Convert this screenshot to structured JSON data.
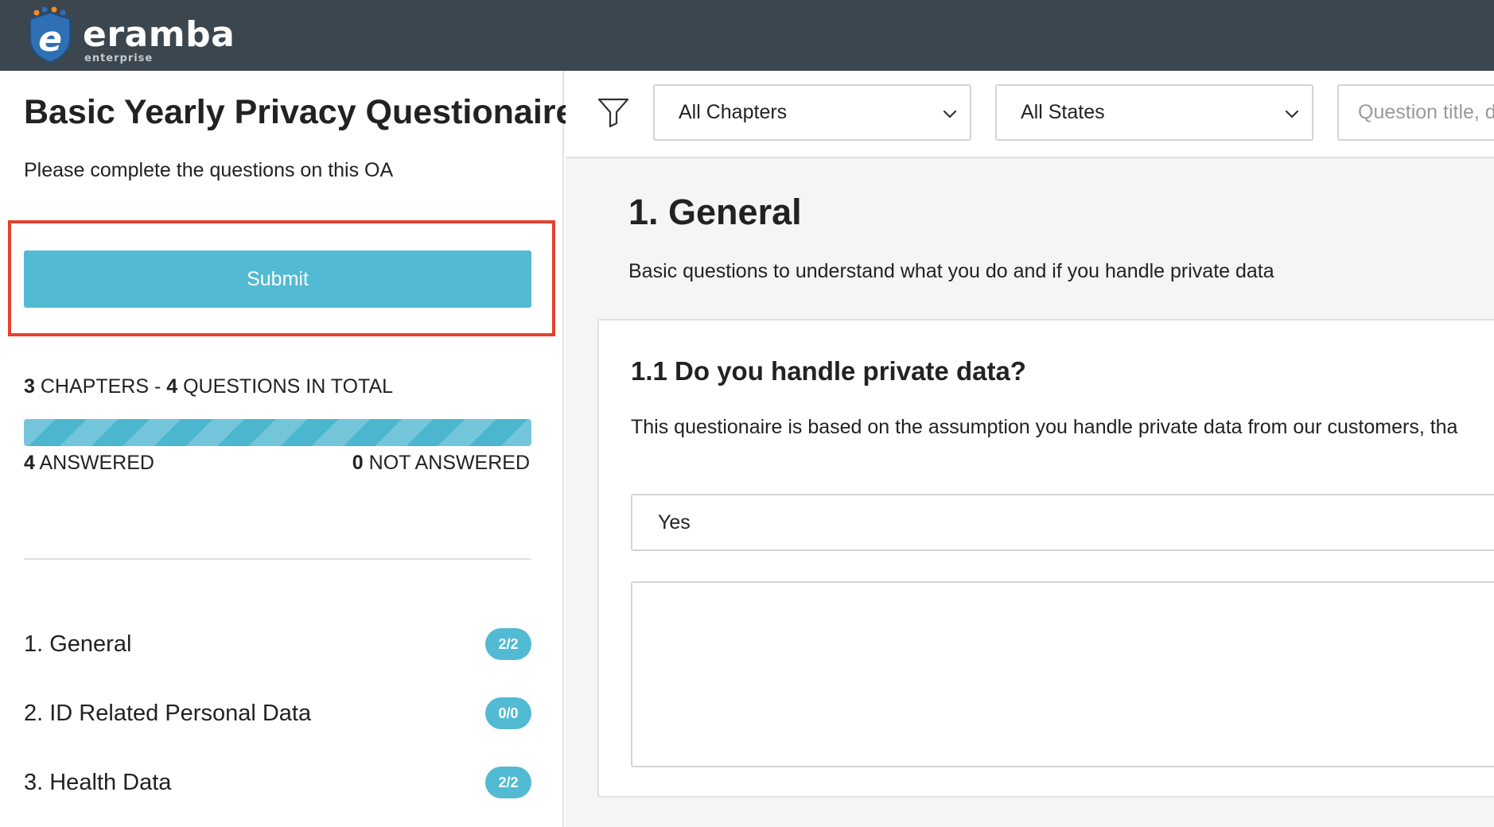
{
  "brand": {
    "name": "eramba",
    "edition": "enterprise",
    "colors": {
      "topbar": "#3b464f",
      "accent": "#52bad2",
      "highlight": "#e5412d"
    }
  },
  "sidebar": {
    "title": "Basic Yearly Privacy Questionaire",
    "description": "Please complete the questions on this OA",
    "submit_label": "Submit",
    "totals": {
      "chapters_count": "3",
      "chapters_text": "CHAPTERS -",
      "questions_count": "4",
      "questions_text": "QUESTIONS IN TOTAL"
    },
    "progress": {
      "answered_fraction": 1.0,
      "answered_count": "4",
      "answered_label": "ANSWERED",
      "not_answered_count": "0",
      "not_answered_label": "NOT ANSWERED"
    },
    "chapters": [
      {
        "label": "1. General",
        "badge": "2/2"
      },
      {
        "label": "2. ID Related Personal Data",
        "badge": "0/0"
      },
      {
        "label": "3. Health Data",
        "badge": "2/2"
      }
    ]
  },
  "filters": {
    "icon": "filter-icon",
    "chapter_select": "All Chapters",
    "state_select": "All States",
    "search_placeholder": "Question title, d"
  },
  "main": {
    "chapter_title": "1. General",
    "chapter_description": "Basic questions to understand what you do and if you handle private data",
    "question": {
      "title": "1.1 Do you handle private data?",
      "text": "This questionaire is based on the assumption you handle private data from our customers, tha",
      "answer": "Yes",
      "comment": ""
    }
  }
}
